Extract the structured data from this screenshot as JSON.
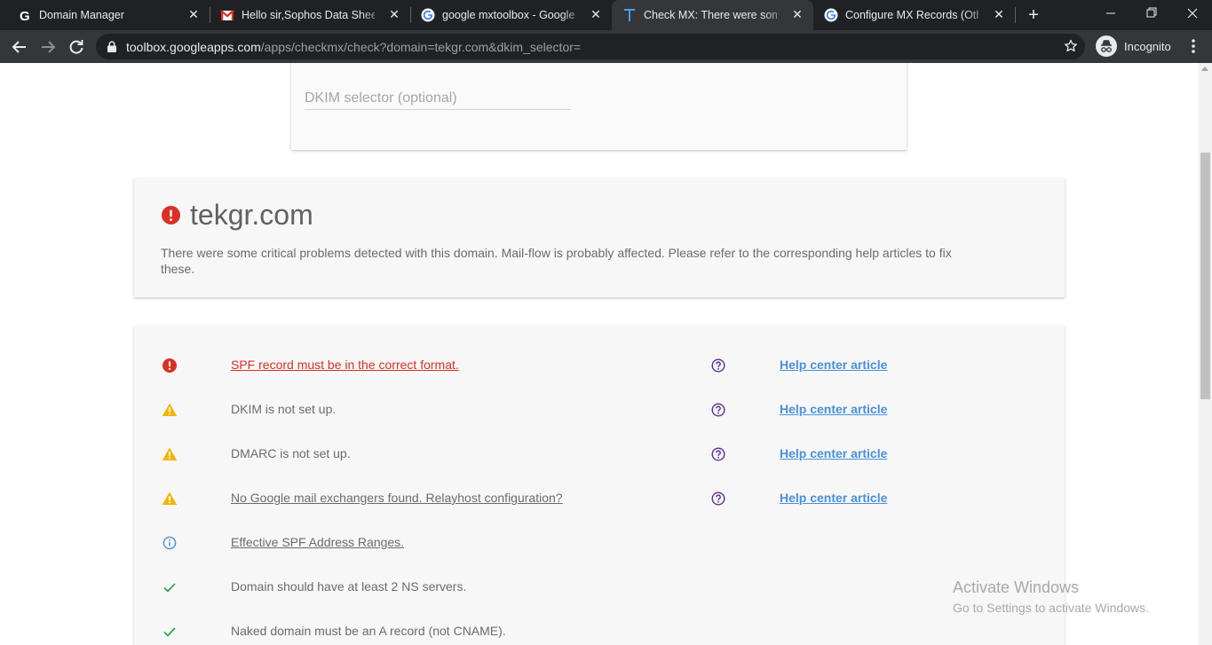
{
  "browser": {
    "tabs": [
      {
        "title": "Domain Manager",
        "favicon": "godaddy-g-icon"
      },
      {
        "title": "Hello sir,Sophos Data Sheet. -",
        "favicon": "gmail-icon"
      },
      {
        "title": "google mxtoolbox - Google Se",
        "favicon": "google-icon"
      },
      {
        "title": "Check MX: There were some cr",
        "favicon": "toolbox-t-icon",
        "active": true
      },
      {
        "title": "Configure MX Records (Other",
        "favicon": "google-icon"
      }
    ],
    "url_host": "toolbox.googleapps.com",
    "url_path": "/apps/checkmx/check?domain=tekgr.com&dkim_selector=",
    "incognito_label": "Incognito"
  },
  "form": {
    "dkim_placeholder": "DKIM selector (optional)",
    "dkim_value": ""
  },
  "summary": {
    "domain": "tekgr.com",
    "status": "critical",
    "description": "There were some critical problems detected with this domain. Mail-flow is probably affected. Please refer to the corresponding help articles to fix these."
  },
  "results": [
    {
      "status": "error",
      "message": "SPF record must be in the correct format.",
      "is_link": true,
      "has_help": true,
      "help_label": "Help center article"
    },
    {
      "status": "warning",
      "message": "DKIM is not set up.",
      "is_link": false,
      "has_help": true,
      "help_label": "Help center article"
    },
    {
      "status": "warning",
      "message": "DMARC is not set up.",
      "is_link": false,
      "has_help": true,
      "help_label": "Help center article"
    },
    {
      "status": "warning",
      "message": "No Google mail exchangers found. Relayhost configuration?",
      "is_link": true,
      "has_help": true,
      "help_label": "Help center article"
    },
    {
      "status": "info",
      "message": "Effective SPF Address Ranges.",
      "is_link": true,
      "has_help": false,
      "help_label": ""
    },
    {
      "status": "ok",
      "message": "Domain should have at least 2 NS servers.",
      "is_link": false,
      "has_help": false,
      "help_label": ""
    },
    {
      "status": "ok",
      "message": "Naked domain must be an A record (not CNAME).",
      "is_link": false,
      "has_help": false,
      "help_label": ""
    }
  ],
  "watermark": {
    "line1": "Activate Windows",
    "line2": "Go to Settings to activate Windows."
  },
  "colors": {
    "error": "#d93025",
    "warning": "#f4b400",
    "info": "#4a90d9",
    "ok": "#34a853",
    "help_icon": "#5c2d91",
    "link": "#4a90d9"
  }
}
